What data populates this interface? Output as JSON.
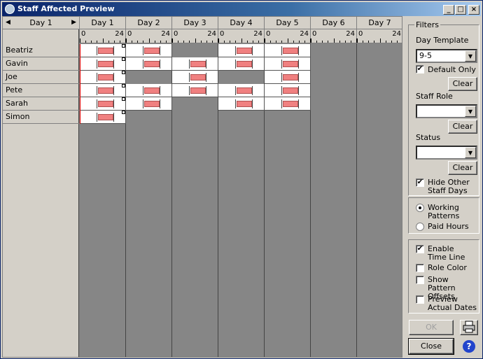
{
  "window": {
    "title": "Staff Affected Preview",
    "controls": {
      "minimize": "_",
      "maximize": "□",
      "close": "×"
    }
  },
  "schedule": {
    "nav": {
      "label": "Day 1",
      "prev_icon": "triangle-left-icon",
      "next_icon": "triangle-right-icon"
    },
    "days": [
      "Day 1",
      "Day 2",
      "Day 3",
      "Day 4",
      "Day 5",
      "Day 6",
      "Day 7"
    ],
    "tick_start": "0",
    "tick_end": "24",
    "staff": [
      {
        "name": "Beatriz",
        "days": [
          true,
          true,
          false,
          true,
          true,
          false,
          false
        ]
      },
      {
        "name": "Gavin",
        "days": [
          true,
          true,
          true,
          true,
          true,
          false,
          false
        ]
      },
      {
        "name": "Joe",
        "days": [
          true,
          false,
          true,
          false,
          true,
          false,
          false
        ]
      },
      {
        "name": "Pete",
        "days": [
          true,
          true,
          true,
          true,
          true,
          false,
          false
        ]
      },
      {
        "name": "Sarah",
        "days": [
          true,
          true,
          false,
          true,
          true,
          false,
          false
        ]
      },
      {
        "name": "Simon",
        "days": [
          true,
          false,
          false,
          false,
          false,
          false,
          false
        ]
      }
    ],
    "colors": {
      "shift": "#f08080",
      "time_line": "#e00000",
      "empty": "#868686"
    }
  },
  "filters": {
    "title": "Filters",
    "day_template_label": "Day Template",
    "day_template_value": "9-5",
    "default_only_label": "Default Only",
    "default_only_checked": true,
    "clear_label": "Clear",
    "staff_role_label": "Staff Role",
    "staff_role_value": "",
    "status_label": "Status",
    "status_value": "",
    "hide_other_label": "Hide Other Staff Days",
    "hide_other_checked": true
  },
  "mode": {
    "working_patterns_label": "Working Patterns",
    "paid_hours_label": "Paid Hours",
    "selected": "working_patterns"
  },
  "options": {
    "enable_time_line_label": "Enable Time Line",
    "enable_time_line_checked": true,
    "role_color_label": "Role Color",
    "role_color_checked": false,
    "show_pattern_offsets_label": "Show Pattern Offsets",
    "show_pattern_offsets_checked": false,
    "preview_actual_dates_label": "Preview Actual Dates",
    "preview_actual_dates_checked": false
  },
  "actions": {
    "ok_label": "OK",
    "close_label": "Close",
    "print_icon": "printer-icon",
    "help_icon": "help-icon"
  }
}
